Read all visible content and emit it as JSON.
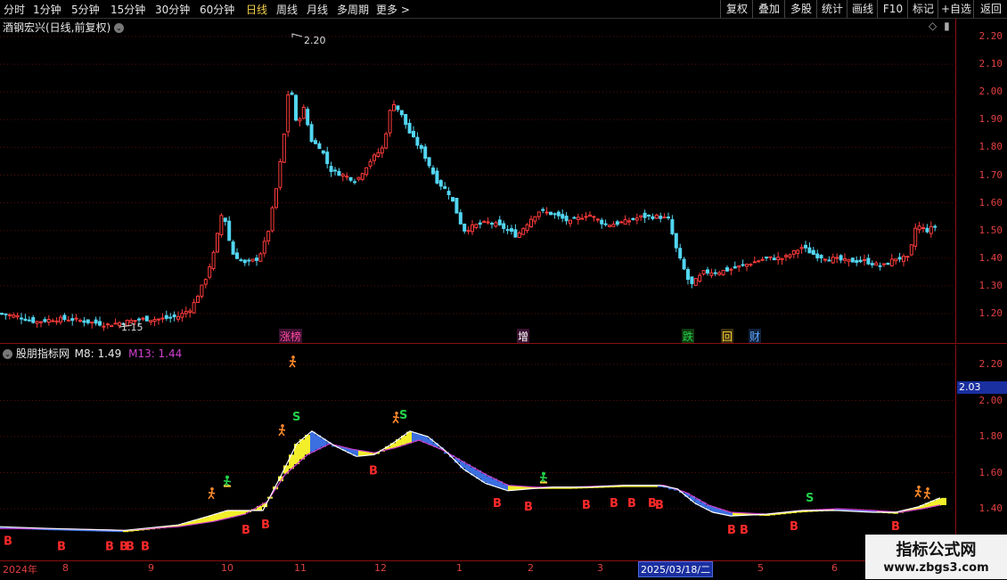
{
  "toolbar": {
    "periods": [
      "分时",
      "1分钟",
      "5分钟",
      "15分钟",
      "30分钟",
      "60分钟",
      "日线",
      "周线",
      "月线",
      "多周期",
      "更多 >"
    ],
    "active_period": "日线",
    "buttons": [
      "复权",
      "叠加",
      "多股",
      "统计",
      "画线",
      "F10",
      "标记",
      "+自选",
      "返回"
    ]
  },
  "main_panel": {
    "title": "酒钢宏兴(日线,前复权)",
    "price_high_label": "2.20",
    "price_low_label": "1.15",
    "y_ticks": [
      "2.20",
      "2.10",
      "2.00",
      "1.90",
      "1.80",
      "1.70",
      "1.60",
      "1.50",
      "1.40",
      "1.30",
      "1.20"
    ],
    "event_markers": [
      {
        "text": "涨榜",
        "color": "#ff4aa0"
      },
      {
        "text": "增",
        "color": "#ffffff"
      },
      {
        "text": "跌",
        "color": "#23d04a"
      },
      {
        "text": "回",
        "color": "#ffd23a"
      },
      {
        "text": "财",
        "color": "#5fa8ff"
      }
    ],
    "chart_data": {
      "type": "candlestick",
      "y_range": [
        1.15,
        2.25
      ],
      "up_color": "#ff3b3b",
      "down_color": "#52d6f2",
      "close_points": [
        [
          0,
          1.2
        ],
        [
          20,
          1.19
        ],
        [
          40,
          1.17
        ],
        [
          60,
          1.18
        ],
        [
          80,
          1.18
        ],
        [
          100,
          1.17
        ],
        [
          120,
          1.16
        ],
        [
          140,
          1.17
        ],
        [
          160,
          1.18
        ],
        [
          180,
          1.18
        ],
        [
          200,
          1.19
        ],
        [
          215,
          1.22
        ],
        [
          230,
          1.32
        ],
        [
          240,
          1.42
        ],
        [
          250,
          1.58
        ],
        [
          260,
          1.42
        ],
        [
          275,
          1.38
        ],
        [
          290,
          1.4
        ],
        [
          300,
          1.48
        ],
        [
          310,
          1.65
        ],
        [
          318,
          1.82
        ],
        [
          325,
          2.05
        ],
        [
          333,
          1.87
        ],
        [
          340,
          1.95
        ],
        [
          350,
          1.82
        ],
        [
          360,
          1.8
        ],
        [
          370,
          1.72
        ],
        [
          385,
          1.7
        ],
        [
          400,
          1.68
        ],
        [
          415,
          1.75
        ],
        [
          430,
          1.8
        ],
        [
          440,
          1.97
        ],
        [
          450,
          1.92
        ],
        [
          460,
          1.85
        ],
        [
          475,
          1.78
        ],
        [
          490,
          1.68
        ],
        [
          505,
          1.63
        ],
        [
          520,
          1.5
        ],
        [
          535,
          1.52
        ],
        [
          550,
          1.53
        ],
        [
          565,
          1.51
        ],
        [
          580,
          1.48
        ],
        [
          595,
          1.54
        ],
        [
          605,
          1.57
        ],
        [
          620,
          1.56
        ],
        [
          640,
          1.53
        ],
        [
          660,
          1.56
        ],
        [
          680,
          1.52
        ],
        [
          700,
          1.53
        ],
        [
          720,
          1.55
        ],
        [
          740,
          1.55
        ],
        [
          750,
          1.54
        ],
        [
          760,
          1.42
        ],
        [
          775,
          1.3
        ],
        [
          790,
          1.35
        ],
        [
          805,
          1.35
        ],
        [
          820,
          1.36
        ],
        [
          840,
          1.38
        ],
        [
          860,
          1.4
        ],
        [
          880,
          1.4
        ],
        [
          900,
          1.44
        ],
        [
          915,
          1.41
        ],
        [
          930,
          1.4
        ],
        [
          950,
          1.39
        ],
        [
          970,
          1.39
        ],
        [
          990,
          1.37
        ],
        [
          1005,
          1.4
        ],
        [
          1020,
          1.4
        ],
        [
          1028,
          1.52
        ],
        [
          1040,
          1.5
        ],
        [
          1052,
          1.52
        ]
      ]
    }
  },
  "indicator_panel": {
    "title": "股朋指标网",
    "m8_label": "M8: 1.49",
    "m13_label": "M13: 1.44",
    "y_ticks": [
      "2.20",
      "2.00",
      "1.80",
      "1.60",
      "1.40"
    ],
    "current_value": "2.03",
    "b_label": "B",
    "s_label": "S",
    "chart_data": {
      "type": "line",
      "series": [
        {
          "name": "M8",
          "color": "#ffffff"
        },
        {
          "name": "M13",
          "color": "#d040d0"
        }
      ],
      "y_range": [
        1.2,
        2.3
      ],
      "m8": [
        [
          0,
          1.3
        ],
        [
          60,
          1.29
        ],
        [
          140,
          1.28
        ],
        [
          200,
          1.31
        ],
        [
          235,
          1.36
        ],
        [
          255,
          1.39
        ],
        [
          295,
          1.39
        ],
        [
          315,
          1.58
        ],
        [
          333,
          1.76
        ],
        [
          350,
          1.83
        ],
        [
          375,
          1.75
        ],
        [
          400,
          1.69
        ],
        [
          420,
          1.7
        ],
        [
          440,
          1.76
        ],
        [
          460,
          1.83
        ],
        [
          480,
          1.8
        ],
        [
          500,
          1.72
        ],
        [
          520,
          1.62
        ],
        [
          545,
          1.54
        ],
        [
          570,
          1.5
        ],
        [
          595,
          1.51
        ],
        [
          620,
          1.52
        ],
        [
          660,
          1.52
        ],
        [
          700,
          1.53
        ],
        [
          740,
          1.53
        ],
        [
          760,
          1.51
        ],
        [
          780,
          1.43
        ],
        [
          800,
          1.38
        ],
        [
          820,
          1.36
        ],
        [
          860,
          1.37
        ],
        [
          900,
          1.39
        ],
        [
          940,
          1.39
        ],
        [
          980,
          1.38
        ],
        [
          1005,
          1.38
        ],
        [
          1030,
          1.41
        ],
        [
          1055,
          1.46
        ]
      ],
      "m13": [
        [
          0,
          1.29
        ],
        [
          60,
          1.29
        ],
        [
          140,
          1.28
        ],
        [
          200,
          1.3
        ],
        [
          240,
          1.33
        ],
        [
          275,
          1.37
        ],
        [
          300,
          1.44
        ],
        [
          320,
          1.59
        ],
        [
          345,
          1.7
        ],
        [
          370,
          1.76
        ],
        [
          395,
          1.73
        ],
        [
          420,
          1.71
        ],
        [
          445,
          1.74
        ],
        [
          470,
          1.78
        ],
        [
          495,
          1.73
        ],
        [
          520,
          1.66
        ],
        [
          545,
          1.59
        ],
        [
          570,
          1.53
        ],
        [
          600,
          1.52
        ],
        [
          640,
          1.52
        ],
        [
          700,
          1.53
        ],
        [
          745,
          1.53
        ],
        [
          770,
          1.49
        ],
        [
          795,
          1.42
        ],
        [
          820,
          1.38
        ],
        [
          860,
          1.37
        ],
        [
          900,
          1.39
        ],
        [
          940,
          1.4
        ],
        [
          980,
          1.39
        ],
        [
          1010,
          1.38
        ],
        [
          1035,
          1.4
        ],
        [
          1055,
          1.42
        ]
      ],
      "b_markers": [
        [
          8,
          1.27
        ],
        [
          68,
          1.24
        ],
        [
          122,
          1.24
        ],
        [
          138,
          1.24
        ],
        [
          145,
          1.24
        ],
        [
          162,
          1.24
        ],
        [
          275,
          1.33
        ],
        [
          297,
          1.36
        ],
        [
          418,
          1.66
        ],
        [
          557,
          1.48
        ],
        [
          592,
          1.46
        ],
        [
          657,
          1.47
        ],
        [
          688,
          1.48
        ],
        [
          708,
          1.48
        ],
        [
          731,
          1.48
        ],
        [
          739,
          1.47
        ],
        [
          820,
          1.33
        ],
        [
          834,
          1.33
        ],
        [
          890,
          1.35
        ],
        [
          1004,
          1.35
        ]
      ],
      "s_markers": [
        [
          332,
          1.87
        ],
        [
          452,
          1.88
        ],
        [
          908,
          1.42
        ]
      ]
    }
  },
  "date_axis": {
    "labels": [
      "2024年",
      "8",
      "9",
      "10",
      "11",
      "12",
      "1",
      "2",
      "3",
      "2025/03/18/二",
      "5",
      "6"
    ]
  },
  "watermark": {
    "title": "指标公式网",
    "url": "www.zbgs3.com"
  }
}
